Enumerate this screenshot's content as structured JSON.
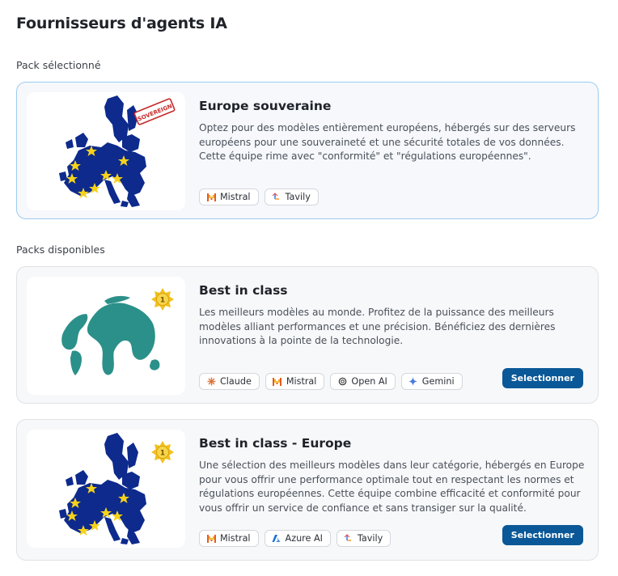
{
  "page": {
    "title": "Fournisseurs d'agents IA"
  },
  "selected_section": {
    "label": "Pack sélectionné"
  },
  "available_section": {
    "label": "Packs disponibles"
  },
  "packs": {
    "europe_souveraine": {
      "title": "Europe souveraine",
      "description": "Optez pour des modèles entièrement européens, hébergés sur des serveurs européens pour une souveraineté et une sécurité totales de vos données. Cette équipe rime avec \"conformité\" et \"régulations européennes\".",
      "stamp_text": "SOVEREIGN",
      "image_icon": "eu-map-icon",
      "tags": [
        {
          "label": "Mistral",
          "icon": "mistral-icon"
        },
        {
          "label": "Tavily",
          "icon": "tavily-icon"
        }
      ]
    },
    "best_in_class": {
      "title": "Best in class",
      "description": "Les meilleurs modèles au monde. Profitez de la puissance des meilleurs modèles alliant performances et une précision. Bénéficiez des dernières innovations à la pointe de la technologie.",
      "badge_text": "1",
      "image_icon": "globe-icon",
      "button_label": "Selectionner",
      "tags": [
        {
          "label": "Claude",
          "icon": "claude-icon"
        },
        {
          "label": "Mistral",
          "icon": "mistral-icon"
        },
        {
          "label": "Open AI",
          "icon": "openai-icon"
        },
        {
          "label": "Gemini",
          "icon": "gemini-icon"
        }
      ]
    },
    "best_in_class_europe": {
      "title": "Best in class - Europe",
      "description": "Une sélection des meilleurs modèles dans leur catégorie, hébergés en Europe pour vous offrir une performance optimale tout en respectant les normes et régulations européennes. Cette équipe combine efficacité et conformité pour vous offrir un service de confiance et sans transiger sur la qualité.",
      "badge_text": "1",
      "image_icon": "eu-map-icon",
      "button_label": "Selectionner",
      "tags": [
        {
          "label": "Mistral",
          "icon": "mistral-icon"
        },
        {
          "label": "Azure AI",
          "icon": "azure-icon"
        },
        {
          "label": "Tavily",
          "icon": "tavily-icon"
        }
      ]
    }
  },
  "colors": {
    "eu_map": "#0d2a8c",
    "eu_star": "#f6d21b",
    "globe": "#2b9089",
    "stamp_red": "#c62828",
    "badge_gold": "#f3c01c",
    "button_blue": "#0a5897",
    "selected_border": "#9ccbef"
  }
}
